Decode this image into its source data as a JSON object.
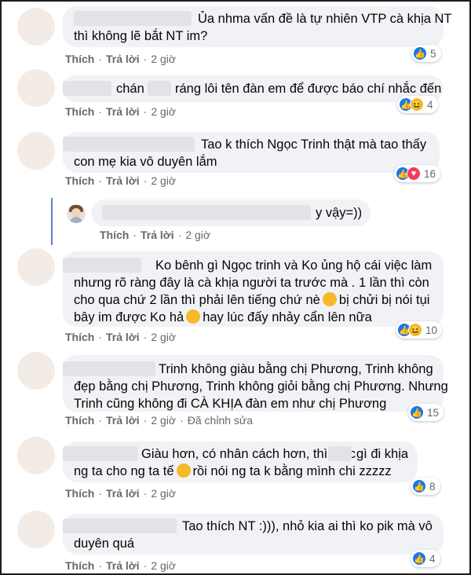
{
  "comments": [
    {
      "lines": [
        "Ủa nhma vấn đề là tự nhiên VTP cà khịa NT",
        "thì không lẽ bắt NT im?"
      ],
      "actions": {
        "like": "Thích",
        "reply": "Trả lời",
        "time": "2 giờ"
      },
      "reactions": {
        "icons": [
          "like-icon"
        ],
        "count": "5"
      }
    },
    {
      "lines": [
        "chán",
        "ráng lôi tên đàn em để được báo chí nhắc đến"
      ],
      "actions": {
        "like": "Thích",
        "reply": "Trả lời",
        "time": "2 giờ"
      },
      "reactions": {
        "icons": [
          "like-icon",
          "haha-icon"
        ],
        "count": "4"
      }
    },
    {
      "lines": [
        "Tao k thích Ngọc Trinh thật mà tao thấy",
        "con mẹ kia vô duyên lắm"
      ],
      "actions": {
        "like": "Thích",
        "reply": "Trả lời",
        "time": "2 giờ"
      },
      "reactions": {
        "icons": [
          "like-icon",
          "love-icon"
        ],
        "count": "16"
      }
    },
    {
      "lines": [
        "y vậy=))"
      ],
      "actions": {
        "like": "Thích",
        "reply": "Trả lời",
        "time": "2 giờ"
      }
    },
    {
      "lines": [
        "Ko bênh gì Ngọc trinh và Ko ủng hộ cái việc làm",
        "nhưng rõ ràng đây là cà khịa người ta trước mà . 1 lần thì còn",
        "cho qua chứ 2 lần thì phải lên tiếng chứ nè",
        "bị chửi bị nói tụi",
        "bây im được Ko hả",
        "hay lúc đấy nhảy cẩn lên nữa"
      ],
      "actions": {
        "like": "Thích",
        "reply": "Trả lời",
        "time": "2 giờ"
      },
      "reactions": {
        "icons": [
          "like-icon",
          "haha-icon"
        ],
        "count": "10"
      }
    },
    {
      "lines": [
        "Trinh không giàu bằng chị Phương, Trinh không",
        "đẹp bằng chị Phương, Trinh không giỏi bằng chị Phương. Nhưng",
        "Trinh cũng không đi CÀ KHỊA đàn em như chị Phương"
      ],
      "actions": {
        "like": "Thích",
        "reply": "Trả lời",
        "time": "2 giờ",
        "edited": "Đã chỉnh sửa"
      },
      "reactions": {
        "icons": [
          "like-icon"
        ],
        "count": "15"
      }
    },
    {
      "lines": [
        "Giàu hơn, có nhân cách hơn, thì mắc",
        "gì đi khịa",
        "ng ta cho ng ta tế",
        "rồi nói ng ta k bằng mình chi zzzzz"
      ],
      "actions": {
        "like": "Thích",
        "reply": "Trả lời",
        "time": "2 giờ"
      },
      "reactions": {
        "icons": [
          "like-icon"
        ],
        "count": "8"
      }
    },
    {
      "lines": [
        "Tao thích NT :))), nhỏ kia ai thì ko pik mà vô",
        "duyên quá"
      ],
      "actions": {
        "like": "Thích",
        "reply": "Trả lời",
        "time": "2 giờ"
      },
      "reactions": {
        "icons": [
          "like-icon"
        ],
        "count": "4"
      }
    }
  ],
  "icons": {
    "like": "like-icon",
    "haha": "haha-icon",
    "love": "love-icon",
    "emoji": "grinning-emoji-icon"
  },
  "colors": {
    "like": "#1877f2",
    "haha": "#f7b928",
    "love": "#f33e58",
    "bubble": "#f0f2f5",
    "meta": "#65676b"
  }
}
